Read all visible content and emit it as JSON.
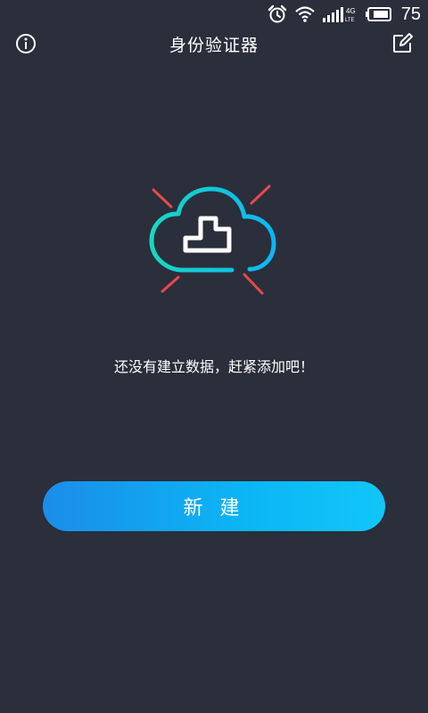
{
  "status_bar": {
    "battery_level": "75",
    "network_badge_top": "4G",
    "network_badge_bottom": "LTE",
    "icons": [
      "alarm-icon",
      "wifi-icon",
      "signal-icon",
      "battery-icon"
    ]
  },
  "header": {
    "title": "身份验证器",
    "left_icon": "info-icon",
    "right_icon": "edit-icon"
  },
  "empty_state": {
    "icon": "cloud-upload-icon",
    "message": "还没有建立数据，赶紧添加吧！"
  },
  "new_button": {
    "label": "新 建"
  },
  "colors": {
    "background": "#2b2e3b",
    "accent_cyan": "#17d8c0",
    "accent_blue": "#0cb6f5",
    "alert_red": "#e8494c",
    "button_gradient_start": "#1a8de9",
    "button_gradient_end": "#11c6f8"
  }
}
